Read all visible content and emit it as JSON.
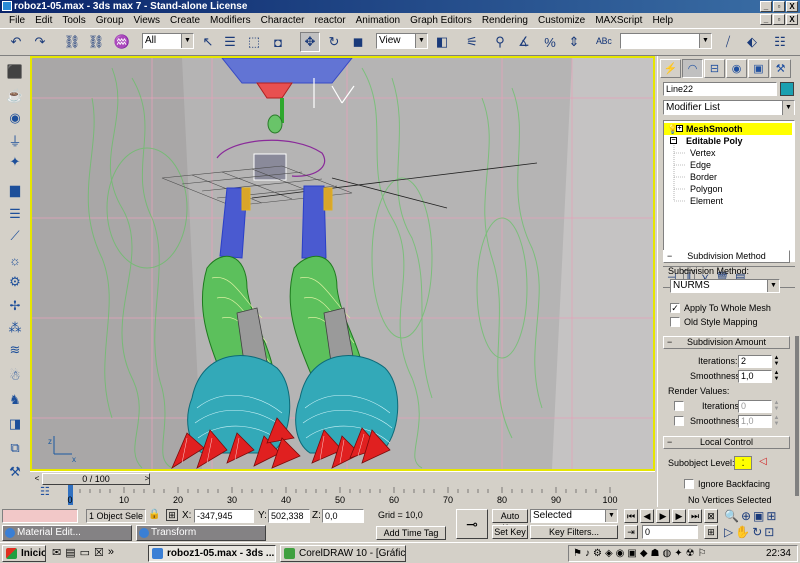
{
  "window": {
    "title": "roboz1-05.max - 3ds max 7 - Stand-alone License",
    "controls": [
      "_",
      "▫",
      "X"
    ]
  },
  "menu": [
    "File",
    "Edit",
    "Tools",
    "Group",
    "Views",
    "Create",
    "Modifiers",
    "Character",
    "reactor",
    "Animation",
    "Graph Editors",
    "Rendering",
    "Customize",
    "MAXScript",
    "Help"
  ],
  "toolbar": {
    "selection_filter": "All",
    "reference_coord": "View",
    "named_selection": ""
  },
  "viewport": {
    "axis_labels": [
      "z",
      "x"
    ]
  },
  "timeslider": {
    "label": "0 / 100",
    "prev": "<",
    "next": ">"
  },
  "trackbar": {
    "ticks": [
      "0",
      "10",
      "20",
      "30",
      "40",
      "50",
      "60",
      "70",
      "80",
      "90",
      "100"
    ]
  },
  "status": {
    "objects_selected": "1 Object Sele",
    "x_label": "X:",
    "x_value": "-347,945",
    "y_label": "Y:",
    "y_value": "502,338",
    "z_label": "Z:",
    "z_value": "0,0",
    "grid": "Grid = 10,0",
    "add_time_tag": "Add Time Tag",
    "auto_key": "Auto Key",
    "set_key": "Set Key",
    "key_mode": "Selected",
    "key_filters": "Key Filters...",
    "frame": "0"
  },
  "command_panel": {
    "object_name": "Line22",
    "object_color": "#1aa0b0",
    "modifier_list": "Modifier List",
    "stack": [
      {
        "label": "MeshSmooth",
        "selected": true
      },
      {
        "label": "Editable Poly",
        "selected": false
      },
      {
        "label": "Vertex",
        "selected": false
      },
      {
        "label": "Edge",
        "selected": false
      },
      {
        "label": "Border",
        "selected": false
      },
      {
        "label": "Polygon",
        "selected": false
      },
      {
        "label": "Element",
        "selected": false
      }
    ],
    "subdivision_method": {
      "header": "Subdivision Method",
      "label": "Subdivision Method:",
      "method": "NURMS",
      "apply_whole_mesh": "Apply To Whole Mesh",
      "apply_whole_mesh_checked": true,
      "old_style_mapping": "Old Style Mapping",
      "old_style_mapping_checked": false
    },
    "subdivision_amount": {
      "header": "Subdivision Amount",
      "iterations_label": "Iterations:",
      "iterations": "2",
      "smoothness_label": "Smoothness:",
      "smoothness": "1,0",
      "render_values": "Render Values:",
      "render_iterations_label": "Iterations:",
      "render_iterations": "0",
      "render_smoothness_label": "Smoothness:",
      "render_smoothness": "1,0"
    },
    "local_control": {
      "header": "Local Control",
      "subobject_label": "Subobject Level:",
      "ignore_backfacing": "Ignore Backfacing",
      "no_vertices": "No Vertices Selected"
    }
  },
  "mini_windows": [
    {
      "label": "Material Edit..."
    },
    {
      "label": "Transform"
    }
  ],
  "taskbar": {
    "start": "Inicio",
    "tasks": [
      {
        "label": "roboz1-05.max - 3ds ...",
        "active": true
      },
      {
        "label": "CorelDRAW 10 - [Gráfico1]",
        "active": false
      }
    ],
    "clock": "22:34",
    "chevron": "»"
  },
  "colors": {
    "viewport_border": "#e6e600",
    "selected_stack": "#ffff00",
    "wire_green": "#2ea82e",
    "wire_cyan": "#1e9aa8",
    "wire_red": "#e02020"
  }
}
